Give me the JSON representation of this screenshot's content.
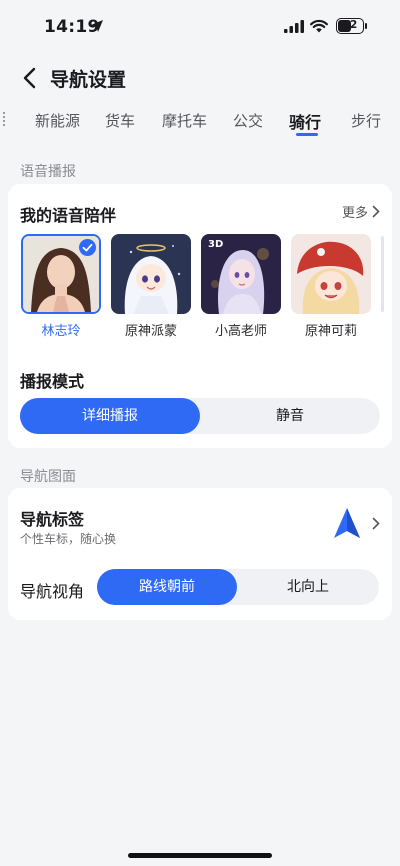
{
  "status_bar": {
    "time": "14:19",
    "battery": "52"
  },
  "header": {
    "title": "导航设置"
  },
  "tabs": [
    {
      "label": "新能源"
    },
    {
      "label": "货车"
    },
    {
      "label": "摩托车"
    },
    {
      "label": "公交"
    },
    {
      "label": "骑行",
      "active": true
    },
    {
      "label": "步行"
    }
  ],
  "voice_section": {
    "header": "语音播报",
    "companion_title": "我的语音陪伴",
    "more_label": "更多",
    "voices": [
      {
        "name": "林志玲",
        "selected": true
      },
      {
        "name": "原神派蒙"
      },
      {
        "name": "小高老师",
        "badge": "3D"
      },
      {
        "name": "原神可莉"
      }
    ],
    "mode_title": "播报模式",
    "mode_options": [
      "详细播报",
      "静音"
    ],
    "mode_selected": "详细播报"
  },
  "nav_section": {
    "header": "导航图面",
    "marker_title": "导航标签",
    "marker_subtitle": "个性车标，随心换",
    "view_title": "导航视角",
    "view_options": [
      "路线朝前",
      "北向上"
    ],
    "view_selected": "路线朝前"
  },
  "colors": {
    "accent": "#2f6af5",
    "background": "#f4f5f7"
  }
}
